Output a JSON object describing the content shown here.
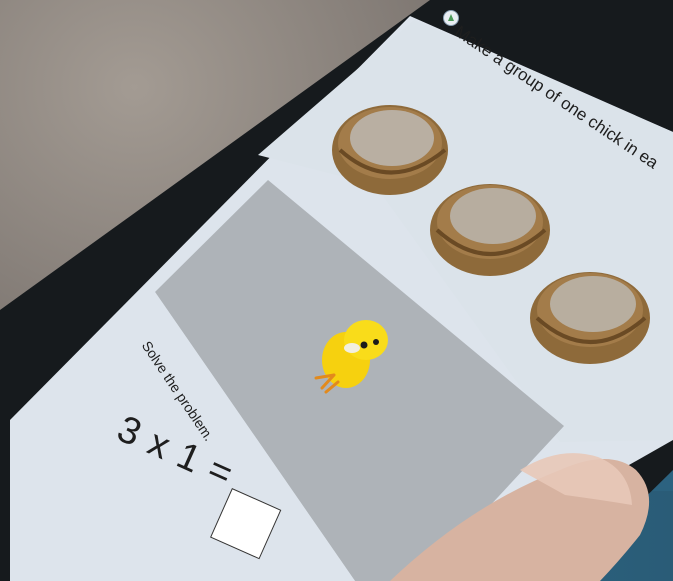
{
  "activity": {
    "instruction": "Make a group of one chick in ea",
    "prompt": "Solve the problem.",
    "equation": "3 x 1 =",
    "answer_value": "",
    "audio_icon": "speaker-icon"
  },
  "scene": {
    "nests": [
      {
        "name": "nest-1"
      },
      {
        "name": "nest-2"
      },
      {
        "name": "nest-3"
      }
    ],
    "chick": {
      "name": "chick"
    },
    "drop_area_color": "#aeb3b8",
    "panel_color": "#dfe6ee"
  }
}
